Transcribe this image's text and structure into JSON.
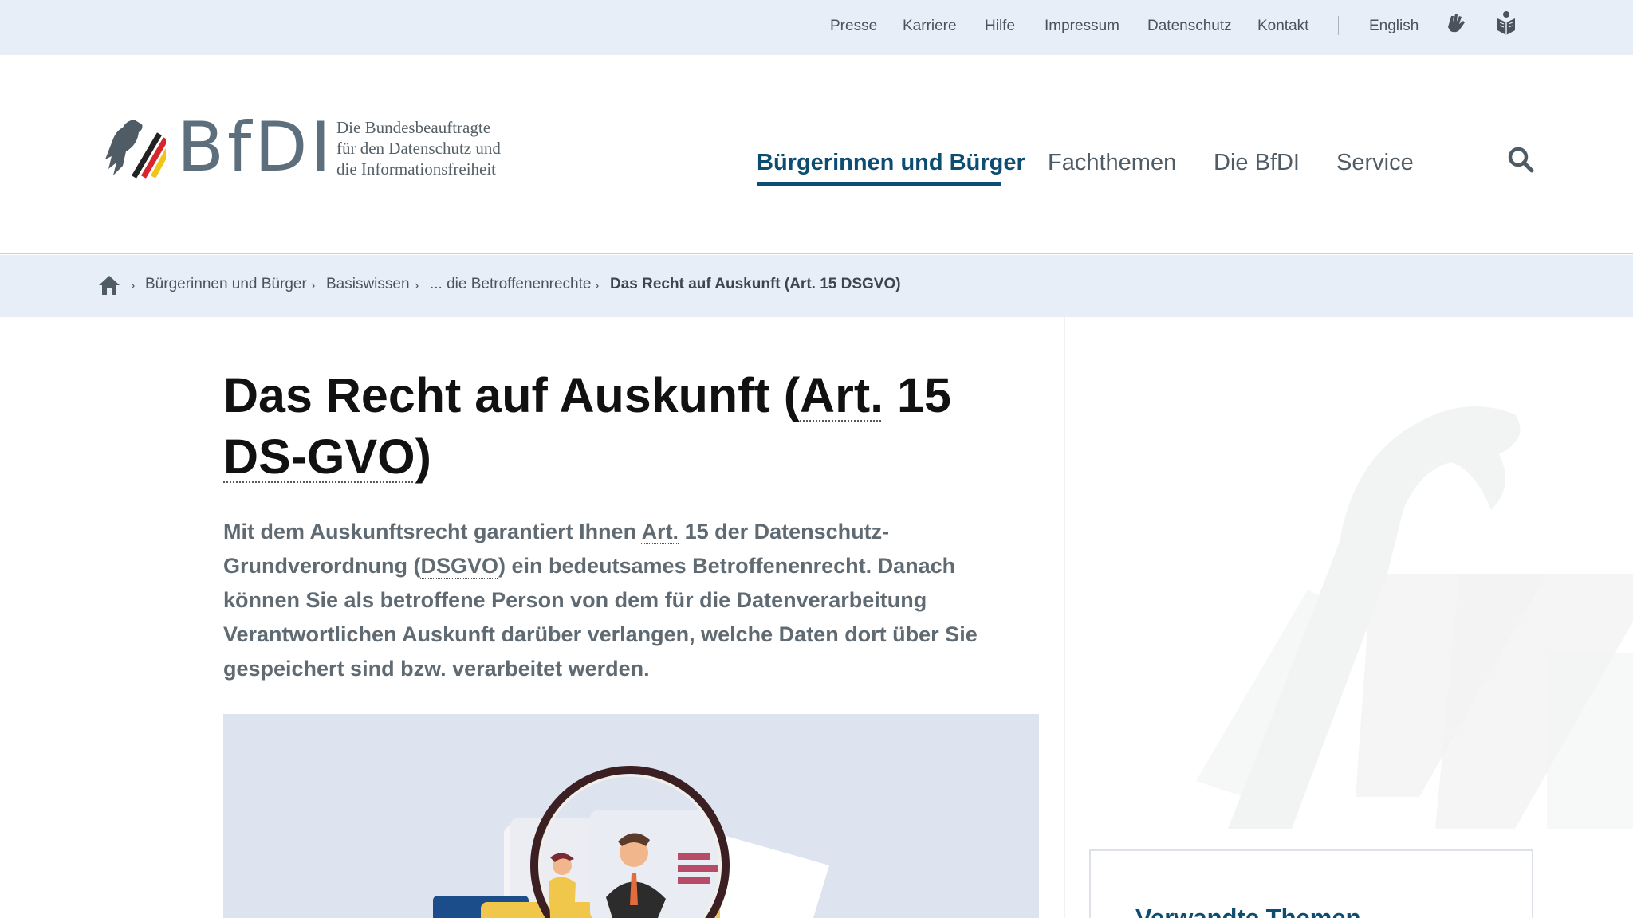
{
  "topbar": {
    "links": [
      "Presse",
      "Karriere",
      "Hilfe",
      "Impressum",
      "Datenschutz",
      "Kontakt"
    ],
    "language": "English",
    "icons": [
      "sign-language-icon",
      "easy-language-icon"
    ]
  },
  "logo": {
    "wordmark": "BfDI",
    "subtitle": [
      "Die Bundesbeauftragte",
      "für den Datenschutz und",
      "die Informationsfreiheit"
    ]
  },
  "mainnav": {
    "items": [
      "Bürgerinnen und Bürger",
      "Fachthemen",
      "Die BfDI",
      "Service"
    ],
    "active": "Bürgerinnen und Bürger"
  },
  "breadcrumb": {
    "items": [
      "Bürgerinnen und Bürger",
      "Basiswissen",
      "... die Betroffenenrechte",
      "Das Recht auf Auskunft (Art. 15 DSGVO)"
    ]
  },
  "article": {
    "title_parts": [
      "Das Recht auf Auskunft (",
      "Art.",
      " 15 ",
      "DS-GVO",
      ")"
    ],
    "lead_parts": [
      "Mit dem Auskunftsrecht garantiert Ihnen ",
      "Art.",
      " 15 der Datenschutz-Grundverordnung (",
      "DSGVO",
      ") ein bedeutsames Betroffenenrecht. Danach können Sie als betroffene Person von dem für die Datenverarbeitung Verantwortlichen Auskunft darüber verlangen, welche Daten dort über Sie gespeichert sind ",
      "bzw.",
      " verarbeitet werden."
    ]
  },
  "sidebar": {
    "related_title": "Verwandte Themen"
  },
  "colors": {
    "brand": "#0e4d72",
    "bar_bg": "#e8eef7",
    "text_muted": "#5f6a72"
  }
}
